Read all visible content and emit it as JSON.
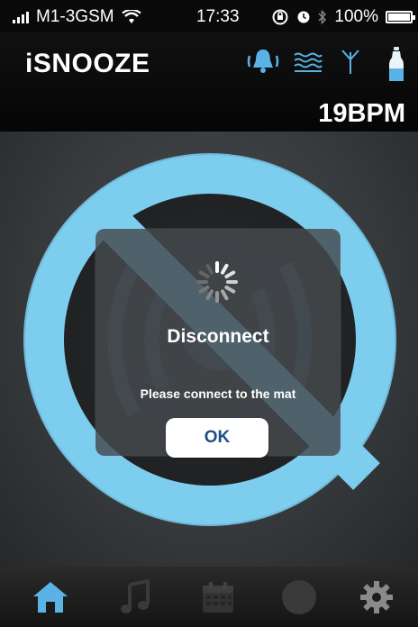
{
  "status_bar": {
    "carrier": "M1-3GSM",
    "time": "17:33",
    "battery": "100%"
  },
  "header": {
    "app_title": "iSNOOZE",
    "bpm": "19BPM",
    "icons": [
      "alarm-bell-icon",
      "wave-icon",
      "antenna-icon",
      "bottle-icon"
    ]
  },
  "main": {
    "icon": "disconnected-signal-icon",
    "accent_color": "#7ccdee"
  },
  "dialog": {
    "title": "Disconnect",
    "message": "Please connect to the mat",
    "ok_label": "OK"
  },
  "tabbar": {
    "tabs": [
      "home-icon",
      "music-note-icon",
      "calendar-icon",
      "circle-icon",
      "gear-icon"
    ],
    "active_tab": "home-icon",
    "active_color": "#5ab2e6"
  }
}
